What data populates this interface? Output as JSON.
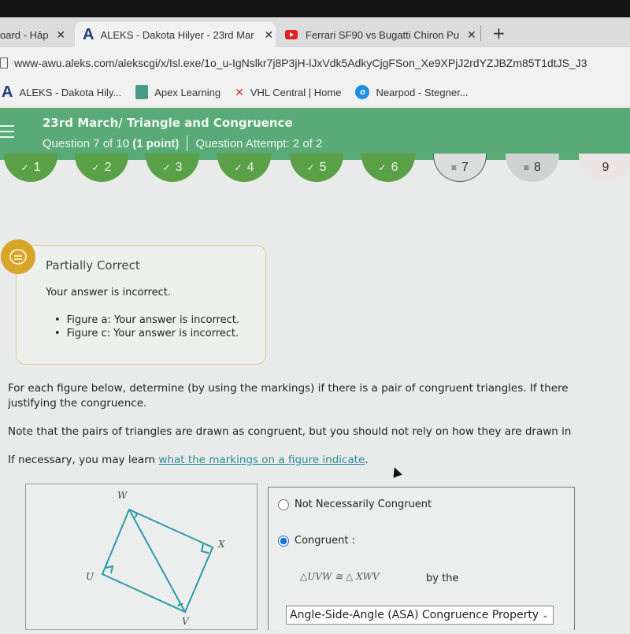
{
  "browser": {
    "tabs": [
      {
        "label": "oard - Hāp",
        "active": false
      },
      {
        "label": "ALEKS - Dakota Hilyer - 23rd Mar",
        "active": true
      },
      {
        "label": "Ferrari SF90 vs Bugatti Chiron Pu",
        "active": false
      }
    ],
    "close_glyph": "✕",
    "new_tab_glyph": "+",
    "url": "www-awu.aleks.com/alekscgi/x/Isl.exe/1o_u-IgNslkr7j8P3jH-lJxVdk5AdkyCjgFSon_Xe9XPjJ2rdYZJBZm85T1dtJS_J3",
    "bookmarks": [
      {
        "label": "ALEKS - Dakota Hily...",
        "icon": "aleks-logo"
      },
      {
        "label": "Apex Learning",
        "icon": "apex-logo"
      },
      {
        "label": "VHL Central | Home",
        "icon": "vhl-logo"
      },
      {
        "label": "Nearpod - Stegner...",
        "icon": "nearpod-logo"
      }
    ]
  },
  "header": {
    "title": "23rd March/ Triangle and Congruence",
    "question": "Question 7 of 10",
    "points": "(1 point)",
    "attempt": "Question Attempt: 2 of 2"
  },
  "question_nav": [
    {
      "label": "1",
      "status": "done",
      "glyph": "✓"
    },
    {
      "label": "2",
      "status": "done",
      "glyph": "✓"
    },
    {
      "label": "3",
      "status": "done",
      "glyph": "✓"
    },
    {
      "label": "4",
      "status": "done",
      "glyph": "✓"
    },
    {
      "label": "5",
      "status": "done",
      "glyph": "✓"
    },
    {
      "label": "6",
      "status": "done",
      "glyph": "✓"
    },
    {
      "label": "7",
      "status": "current",
      "glyph": "≡"
    },
    {
      "label": "8",
      "status": "pending",
      "glyph": "≡"
    },
    {
      "label": "9",
      "status": "plain",
      "glyph": ""
    }
  ],
  "feedback": {
    "title": "Partially Correct",
    "message": "Your answer is incorrect.",
    "items": [
      "Figure a: Your answer is incorrect.",
      "Figure c: Your answer is incorrect."
    ]
  },
  "instructions": {
    "line1": "For each figure below, determine (by using the markings) if there is a pair of congruent triangles. If there",
    "line2": "justifying the congruence.",
    "note": "Note that the pairs of triangles are drawn as congruent, but you should not rely on how they are drawn in",
    "help_prefix": "If necessary, you may learn ",
    "help_link": "what the markings on a figure indicate",
    "help_suffix": "."
  },
  "figure": {
    "vertices": {
      "W": "W",
      "X": "X",
      "U": "U",
      "V": "V"
    },
    "stroke_color": "#2a9aa8"
  },
  "answer": {
    "option_not": "Not Necessarily Congruent",
    "option_congruent": "Congruent :",
    "selected": "congruent",
    "statement": "△UVW ≅ △  XWV",
    "by_the": "by the",
    "property": "Angle-Side-Angle (ASA) Congruence Property"
  }
}
